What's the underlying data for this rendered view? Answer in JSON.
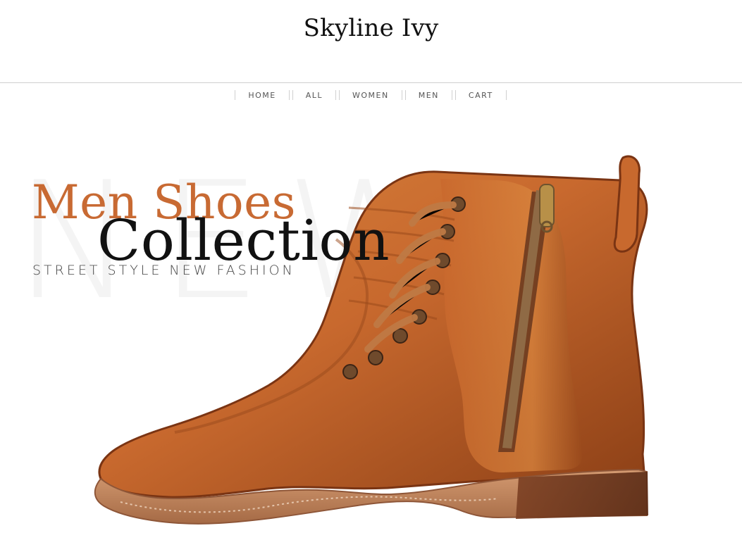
{
  "header": {
    "site_title": "Skyline Ivy"
  },
  "nav": {
    "items": [
      {
        "label": "HOME"
      },
      {
        "label": "ALL"
      },
      {
        "label": "WOMEN"
      },
      {
        "label": "MEN"
      },
      {
        "label": "CART"
      }
    ]
  },
  "hero": {
    "background_text": "NEW",
    "kicker": "Men Shoes",
    "heading": "Collection",
    "subtitle": "STREET STYLE NEW FASHION",
    "colors": {
      "kicker": "#c86a33",
      "boot_primary": "#c8692e",
      "boot_dark": "#8b3f16",
      "sole": "#b97a4f"
    }
  }
}
